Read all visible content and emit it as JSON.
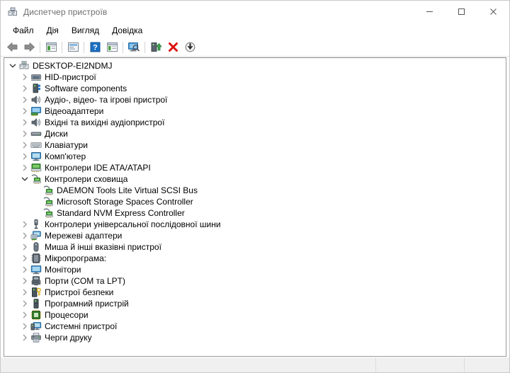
{
  "window": {
    "title": "Диспетчер пристроїв",
    "title_icon": "device-manager-icon",
    "minimize_label": "—",
    "maximize_label": "□",
    "close_label": "✕"
  },
  "menu": {
    "items": [
      {
        "label": "Файл",
        "name": "menu-file"
      },
      {
        "label": "Дія",
        "name": "menu-action"
      },
      {
        "label": "Вигляд",
        "name": "menu-view"
      },
      {
        "label": "Довідка",
        "name": "menu-help"
      }
    ]
  },
  "toolbar": {
    "items": [
      {
        "name": "back-icon",
        "tip": "Назад"
      },
      {
        "name": "forward-icon",
        "tip": "Вперед"
      },
      {
        "name": "show-hide-console-tree-icon",
        "tip": "Показати/приховати дерево консолі"
      },
      {
        "name": "properties-icon",
        "tip": "Властивості"
      },
      {
        "name": "help-icon",
        "tip": "Довідка"
      },
      {
        "name": "view-list-icon",
        "tip": "Вигляд"
      },
      {
        "name": "scan-hardware-changes-icon",
        "tip": "Оновити конфігурацію обладнання"
      },
      {
        "name": "update-driver-icon",
        "tip": "Оновити драйвер"
      },
      {
        "name": "uninstall-device-icon",
        "tip": "Видалити пристрій"
      },
      {
        "name": "disable-device-icon",
        "tip": "Вимкнути пристрій"
      }
    ]
  },
  "tree": {
    "nodes": [
      {
        "label": "DESKTOP-EI2NDMJ",
        "level": 0,
        "state": "expanded",
        "icon": "computer-root-icon",
        "name": "tree-node-root"
      },
      {
        "label": "HID-пристрої",
        "level": 1,
        "state": "collapsed",
        "icon": "hid-icon",
        "name": "tree-node-hid"
      },
      {
        "label": "Software components",
        "level": 1,
        "state": "collapsed",
        "icon": "software-component-icon",
        "name": "tree-node-software-components"
      },
      {
        "label": "Аудіо-, відео- та ігрові пристрої",
        "level": 1,
        "state": "collapsed",
        "icon": "speaker-icon",
        "name": "tree-node-audio-video-game"
      },
      {
        "label": "Відеоадаптери",
        "level": 1,
        "state": "collapsed",
        "icon": "display-adapter-icon",
        "name": "tree-node-display-adapters"
      },
      {
        "label": "Вхідні та вихідні аудіопристрої",
        "level": 1,
        "state": "collapsed",
        "icon": "speaker-icon",
        "name": "tree-node-audio-inputs-outputs"
      },
      {
        "label": "Диски",
        "level": 1,
        "state": "collapsed",
        "icon": "disk-drive-icon",
        "name": "tree-node-disk-drives"
      },
      {
        "label": "Клавіатури",
        "level": 1,
        "state": "collapsed",
        "icon": "keyboard-icon",
        "name": "tree-node-keyboards"
      },
      {
        "label": "Комп'ютер",
        "level": 1,
        "state": "collapsed",
        "icon": "computer-icon",
        "name": "tree-node-computer"
      },
      {
        "label": "Контролери IDE ATA/ATAPI",
        "level": 1,
        "state": "collapsed",
        "icon": "ide-controller-icon",
        "name": "tree-node-ide-ata-atapi"
      },
      {
        "label": "Контролери сховища",
        "level": 1,
        "state": "expanded",
        "icon": "storage-controller-icon",
        "name": "tree-node-storage-controllers"
      },
      {
        "label": "DAEMON Tools Lite Virtual SCSI Bus",
        "level": 2,
        "state": "leaf",
        "icon": "storage-controller-icon",
        "name": "tree-node-daemon-tools-scsi"
      },
      {
        "label": "Microsoft Storage Spaces Controller",
        "level": 2,
        "state": "leaf",
        "icon": "storage-controller-icon",
        "name": "tree-node-ms-storage-spaces"
      },
      {
        "label": "Standard NVM Express Controller",
        "level": 2,
        "state": "leaf",
        "icon": "storage-controller-icon",
        "name": "tree-node-nvm-express"
      },
      {
        "label": "Контролери універсальної послідовної шини",
        "level": 1,
        "state": "collapsed",
        "icon": "usb-icon",
        "name": "tree-node-usb-controllers"
      },
      {
        "label": "Мережеві адаптери",
        "level": 1,
        "state": "collapsed",
        "icon": "network-adapter-icon",
        "name": "tree-node-network-adapters"
      },
      {
        "label": "Миша й інші вказівні пристрої",
        "level": 1,
        "state": "collapsed",
        "icon": "mouse-icon",
        "name": "tree-node-mice"
      },
      {
        "label": "Мікропрограма:",
        "level": 1,
        "state": "collapsed",
        "icon": "firmware-icon",
        "name": "tree-node-firmware"
      },
      {
        "label": "Монітори",
        "level": 1,
        "state": "collapsed",
        "icon": "monitor-icon",
        "name": "tree-node-monitors"
      },
      {
        "label": "Порти (COM та LPT)",
        "level": 1,
        "state": "collapsed",
        "icon": "port-icon",
        "name": "tree-node-ports"
      },
      {
        "label": "Пристрої безпеки",
        "level": 1,
        "state": "collapsed",
        "icon": "security-device-icon",
        "name": "tree-node-security-devices"
      },
      {
        "label": "Програмний пристрій",
        "level": 1,
        "state": "collapsed",
        "icon": "software-device-icon",
        "name": "tree-node-software-devices"
      },
      {
        "label": "Процесори",
        "level": 1,
        "state": "collapsed",
        "icon": "processor-icon",
        "name": "tree-node-processors"
      },
      {
        "label": "Системні пристрої",
        "level": 1,
        "state": "collapsed",
        "icon": "system-device-icon",
        "name": "tree-node-system-devices"
      },
      {
        "label": "Черги друку",
        "level": 1,
        "state": "collapsed",
        "icon": "print-queue-icon",
        "name": "tree-node-print-queues"
      }
    ]
  },
  "statusbar": {
    "pane1": "",
    "pane2": "",
    "pane3": ""
  },
  "colors": {
    "accent_blue": "#2a6fc9",
    "icon_green": "#3f9c35",
    "icon_gray": "#6d7277",
    "close_red": "#e81123",
    "titlebar_text": "#6d6d6d"
  }
}
